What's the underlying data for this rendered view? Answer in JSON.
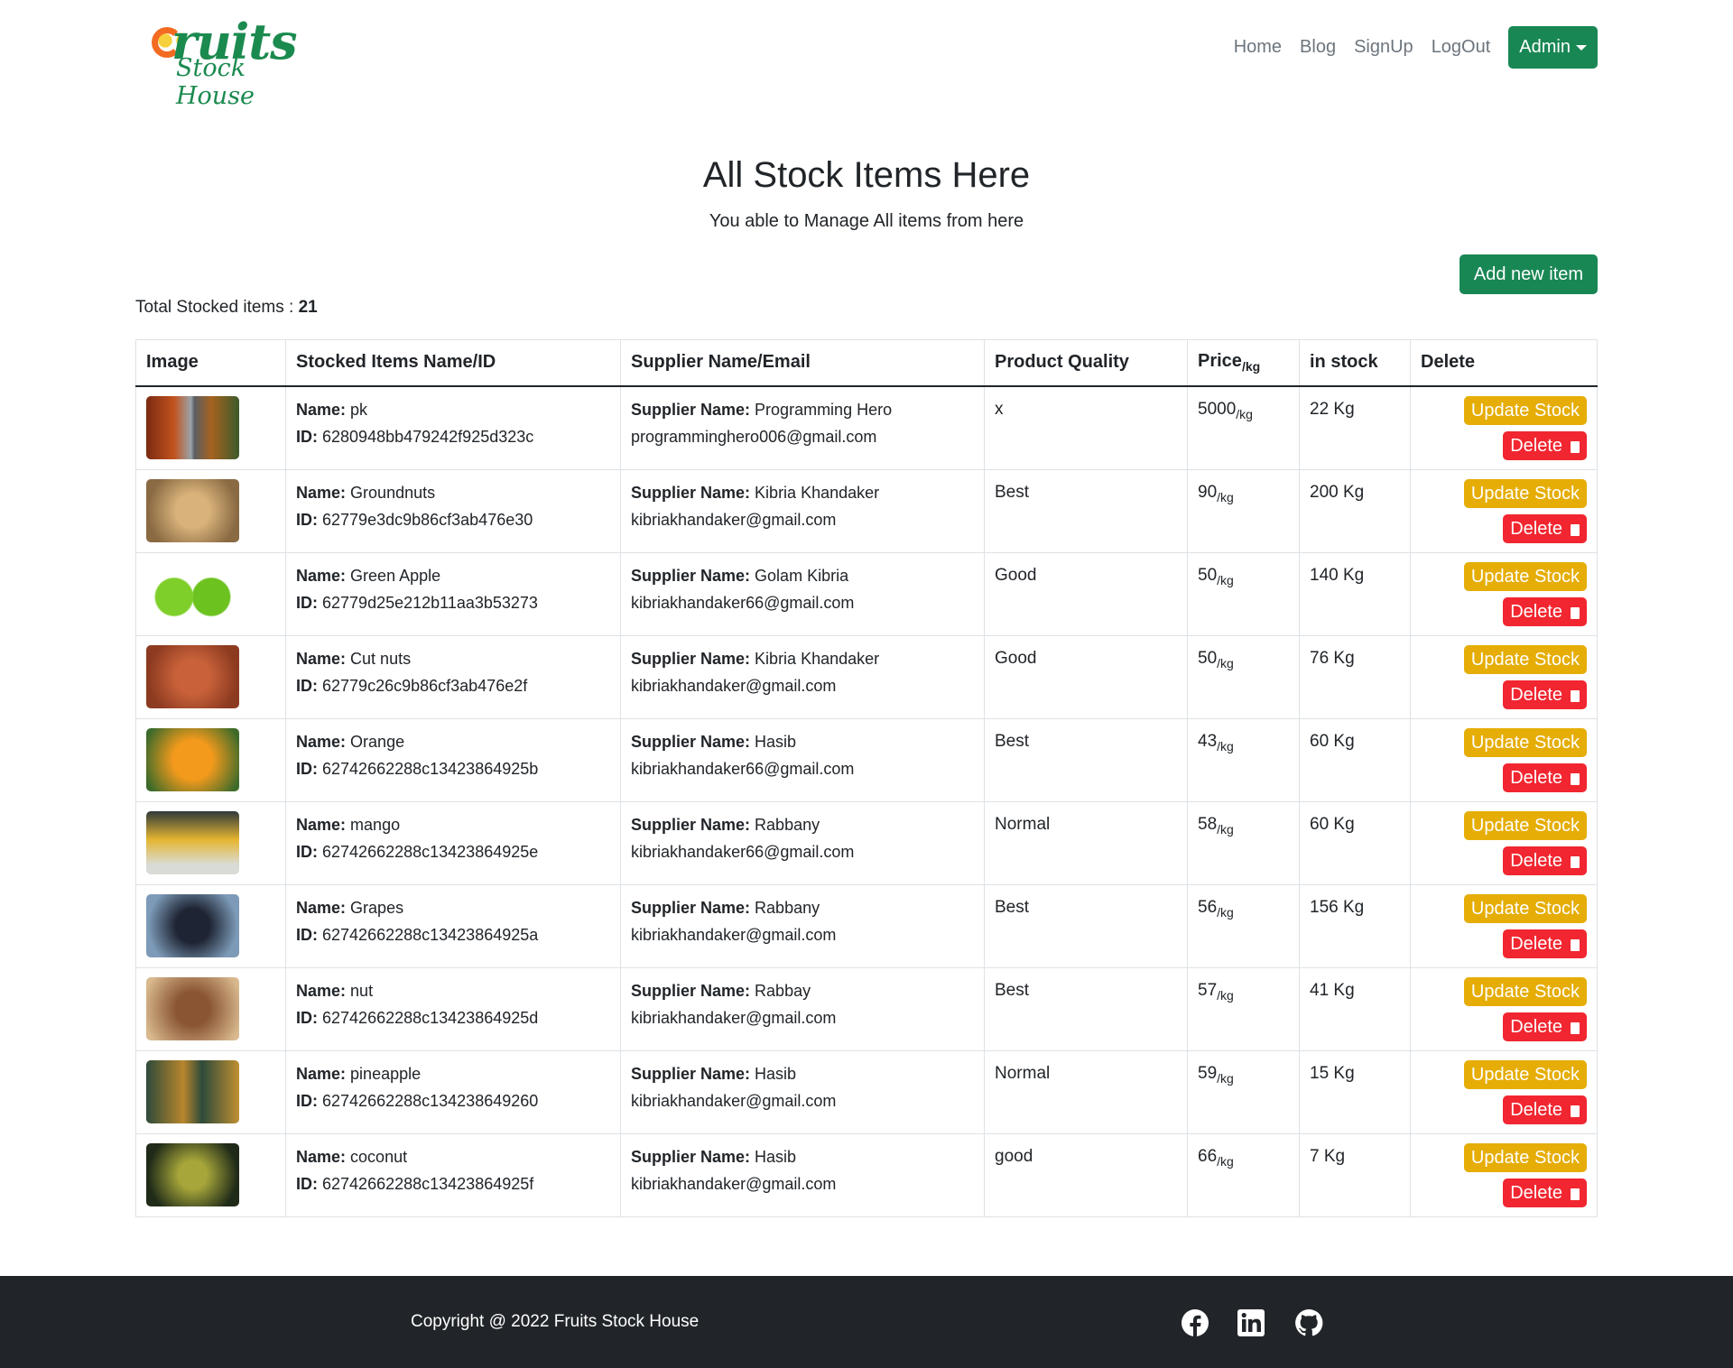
{
  "brand": {
    "logo_text": "Fruits Stock House"
  },
  "nav": {
    "links": [
      "Home",
      "Blog",
      "SignUp",
      "LogOut"
    ],
    "admin": "Admin"
  },
  "page": {
    "title": "All Stock Items Here",
    "subtitle": "You able to Manage All items from here",
    "add_button": "Add new item",
    "total_label": "Total Stocked items : ",
    "total_count": "21"
  },
  "table": {
    "headers": {
      "image": "Image",
      "name": "Stocked Items Name/ID",
      "supplier": "Supplier Name/Email",
      "quality": "Product Quality",
      "price": "Price",
      "price_unit": "/kg",
      "stock": "in stock",
      "delete": "Delete"
    },
    "labels": {
      "name": "Name:",
      "id": "ID:",
      "supplier": "Supplier Name:",
      "per_kg": "/kg",
      "update": "Update Stock",
      "delete": "Delete"
    },
    "rows": [
      {
        "name": "pk",
        "id": "6280948bb479242f925d323c",
        "supplier": "Programming Hero",
        "email": "programminghero006@gmail.com",
        "quality": "x",
        "price": "5000",
        "stock": "22 Kg",
        "img": "linear-gradient(90deg,#7a2a12,#c2521e 30%,#9aa3a8 48%,#5c5f63 52%,#a5621f 70%,#3c5a2a)"
      },
      {
        "name": "Groundnuts",
        "id": "62779e3dc9b86cf3ab476e30",
        "supplier": "Kibria Khandaker",
        "email": "kibriakhandaker@gmail.com",
        "quality": "Best",
        "price": "90",
        "stock": "200 Kg",
        "img": "radial-gradient(circle,#d8b27a 30%,#8a6a43 80%)"
      },
      {
        "name": "Green Apple",
        "id": "62779d25e212b11aa3b53273",
        "supplier": "Golam Kibria",
        "email": "kibriakhandaker66@gmail.com",
        "quality": "Good",
        "price": "50",
        "stock": "140 Kg",
        "img": "radial-gradient(circle at 30% 55%,#7fcf2a 25%,transparent 27%),radial-gradient(circle at 70% 55%,#6cc21f 25%,#fff 27%)"
      },
      {
        "name": "Cut nuts",
        "id": "62779c26c9b86cf3ab476e2f",
        "supplier": "Kibria Khandaker",
        "email": "kibriakhandaker@gmail.com",
        "quality": "Good",
        "price": "50",
        "stock": "76 Kg",
        "img": "radial-gradient(circle,#c9623a 30%,#8c3a20 80%)"
      },
      {
        "name": "Orange",
        "id": "62742662288c13423864925b",
        "supplier": "Hasib",
        "email": "kibriakhandaker66@gmail.com",
        "quality": "Best",
        "price": "43",
        "stock": "60 Kg",
        "img": "radial-gradient(circle,#f39a1c 35%,#3d6b2a 90%)"
      },
      {
        "name": "mango",
        "id": "62742662288c13423864925e",
        "supplier": "Rabbany",
        "email": "kibriakhandaker66@gmail.com",
        "quality": "Normal",
        "price": "58",
        "stock": "60 Kg",
        "img": "linear-gradient(180deg,#2f3a3a,#e5b531 45%,#d9dcd6 85%)"
      },
      {
        "name": "Grapes",
        "id": "62742662288c13423864925a",
        "supplier": "Rabbany",
        "email": "kibriakhandaker@gmail.com",
        "quality": "Best",
        "price": "56",
        "stock": "156 Kg",
        "img": "radial-gradient(circle,#1e2433 30%,#7d9bb8 80%)"
      },
      {
        "name": "nut",
        "id": "62742662288c13423864925d",
        "supplier": "Rabbay",
        "email": "kibriakhandaker@gmail.com",
        "quality": "Best",
        "price": "57",
        "stock": "41 Kg",
        "img": "radial-gradient(circle,#8a5533 30%,#d9b98e 90%)"
      },
      {
        "name": "pineapple",
        "id": "62742662288c134238649260",
        "supplier": "Hasib",
        "email": "kibriakhandaker@gmail.com",
        "quality": "Normal",
        "price": "59",
        "stock": "15 Kg",
        "img": "linear-gradient(90deg,#2d4a3a,#b8862c 40%,#2d4a3a 60%,#c09031)"
      },
      {
        "name": "coconut",
        "id": "62742662288c13423864925f",
        "supplier": "Hasib",
        "email": "kibriakhandaker@gmail.com",
        "quality": "good",
        "price": "66",
        "stock": "7 Kg",
        "img": "radial-gradient(circle,#a6a63a 25%,#1f2a18 80%)"
      }
    ]
  },
  "footer": {
    "copyright": "Copyright @ 2022 Fruits Stock House",
    "icons": [
      "facebook-icon",
      "linkedin-icon",
      "github-icon"
    ]
  }
}
